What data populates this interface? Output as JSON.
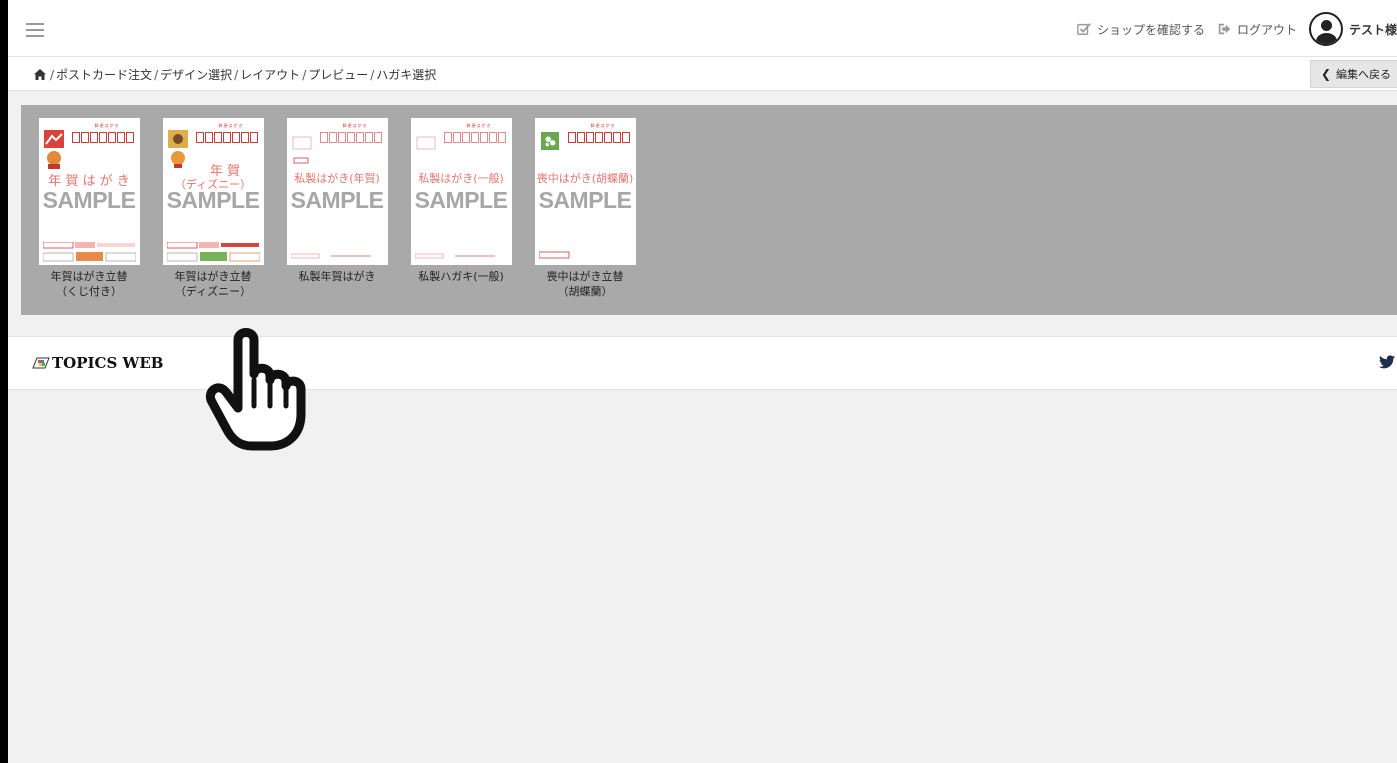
{
  "navbar": {
    "menu_icon": "hamburger-icon",
    "shop_link_label": "ショップを確認する",
    "logout_label": "ログアウト",
    "user_name": "テスト様"
  },
  "breadcrumb": {
    "home_icon": "home-icon",
    "sep": "/",
    "items": [
      "ポストカード注文",
      "デザイン選択",
      "レイアウト",
      "プレビュー",
      "ハガキ選択"
    ]
  },
  "back_button_label": "編集へ戻る",
  "cards": [
    {
      "thumb_text": "年 賀 は が き",
      "sample": "SAMPLE",
      "label_line1": "年賀はがき立替",
      "label_line2": "（くじ付き）"
    },
    {
      "thumb_text": "（ディズニー）",
      "thumb_text_top": "年 賀",
      "sample": "SAMPLE",
      "label_line1": "年賀はがき立替",
      "label_line2": "（ディズニー）"
    },
    {
      "thumb_text": "私製はがき(年賀)",
      "sample": "SAMPLE",
      "label_line1": "私製年賀はがき",
      "label_line2": ""
    },
    {
      "thumb_text": "私製はがき(一般)",
      "sample": "SAMPLE",
      "label_line1": "私製ハガキ(一般)",
      "label_line2": ""
    },
    {
      "thumb_text": "喪中はがき(胡蝶蘭)",
      "sample": "SAMPLE",
      "label_line1": "喪中はがき立替",
      "label_line2": "（胡蝶蘭）"
    }
  ],
  "topics": {
    "logo_text": "TOPICS WEB",
    "twitter_icon": "twitter-icon"
  },
  "colors": {
    "gallery_bg": "#a9a9a9",
    "postal_red": "#d23a3a",
    "mark_pink": "#e7746e"
  }
}
